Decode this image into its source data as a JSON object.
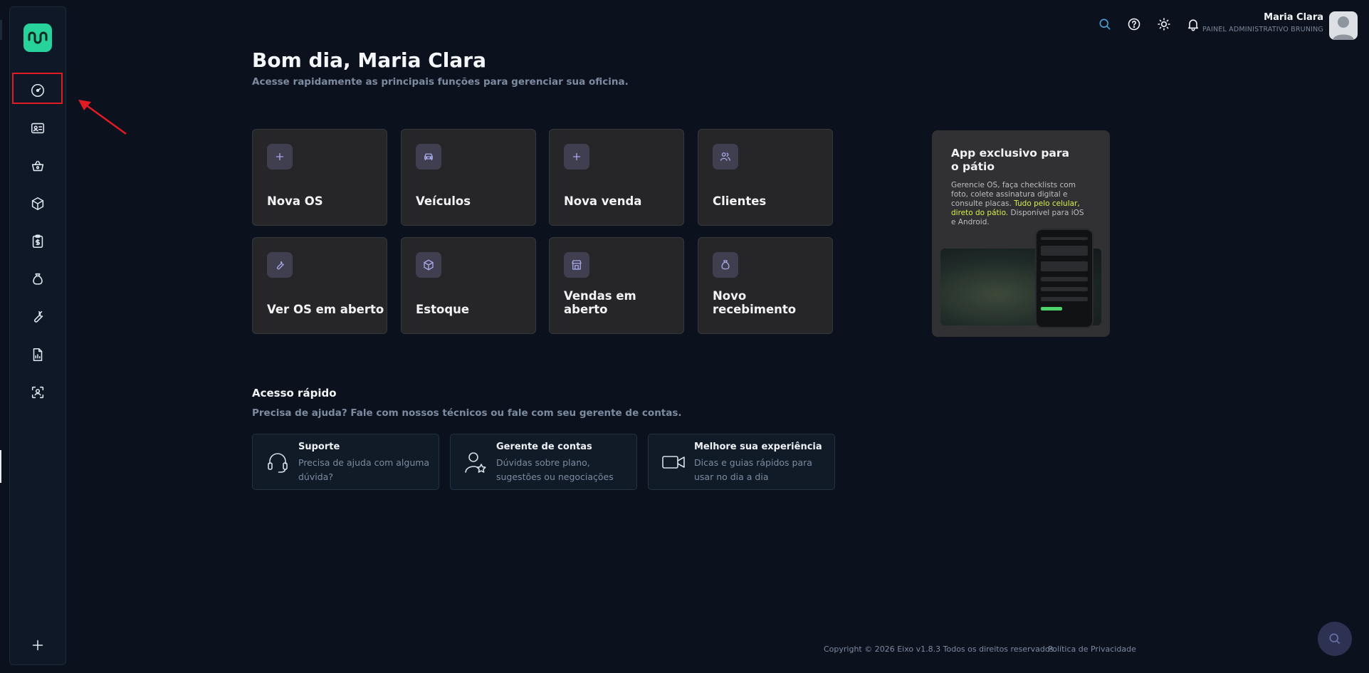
{
  "header": {
    "user_name": "Maria Clara",
    "user_role": "PAINEL ADMINISTRATIVO BRUNING"
  },
  "main": {
    "greeting": "Bom dia, Maria Clara",
    "subtitle": "Acesse rapidamente as principais funções para gerenciar sua oficina.",
    "cards": [
      {
        "label": "Nova OS",
        "icon": "plus-icon"
      },
      {
        "label": "Veículos",
        "icon": "car-icon"
      },
      {
        "label": "Nova venda",
        "icon": "plus-icon"
      },
      {
        "label": "Clientes",
        "icon": "users-icon"
      },
      {
        "label": "Ver OS em aberto",
        "icon": "wrench-icon"
      },
      {
        "label": "Estoque",
        "icon": "box-icon"
      },
      {
        "label": "Vendas em aberto",
        "icon": "store-icon"
      },
      {
        "label": "Novo recebimento",
        "icon": "money-bag-icon"
      }
    ]
  },
  "promo": {
    "title": "App exclusivo para o pátio",
    "text_before": "Gerencie OS, faça checklists com foto, colete assinatura digital e consulte placas. ",
    "text_highlight": "Tudo pelo celular, direto do pátio.",
    "text_after": " Disponível para iOS e Android."
  },
  "quick_access": {
    "title": "Acesso rápido",
    "subtitle": "Precisa de ajuda? Fale com nossos técnicos ou fale com seu gerente de contas.",
    "items": [
      {
        "title": "Suporte",
        "desc": "Precisa de ajuda com alguma dúvida?",
        "icon": "headset-icon"
      },
      {
        "title": "Gerente de contas",
        "desc": "Dúvidas sobre plano, sugestões ou negociações",
        "icon": "user-star-icon"
      },
      {
        "title": "Melhore sua experiência",
        "desc": "Dicas e guias rápidos para usar no dia a dia",
        "icon": "video-icon"
      }
    ]
  },
  "footer": {
    "copyright": "Copyright © 2026 Eixo v1.8.3 Todos os direitos reservados.",
    "privacy": "Política de Privacidade"
  },
  "colors": {
    "background": "#0b121d",
    "accent": "#27d39b",
    "card": "#262628",
    "icon_tint": "#a8a7e6",
    "highlight": "#d8ee4b",
    "annotation": "#e01b24"
  }
}
